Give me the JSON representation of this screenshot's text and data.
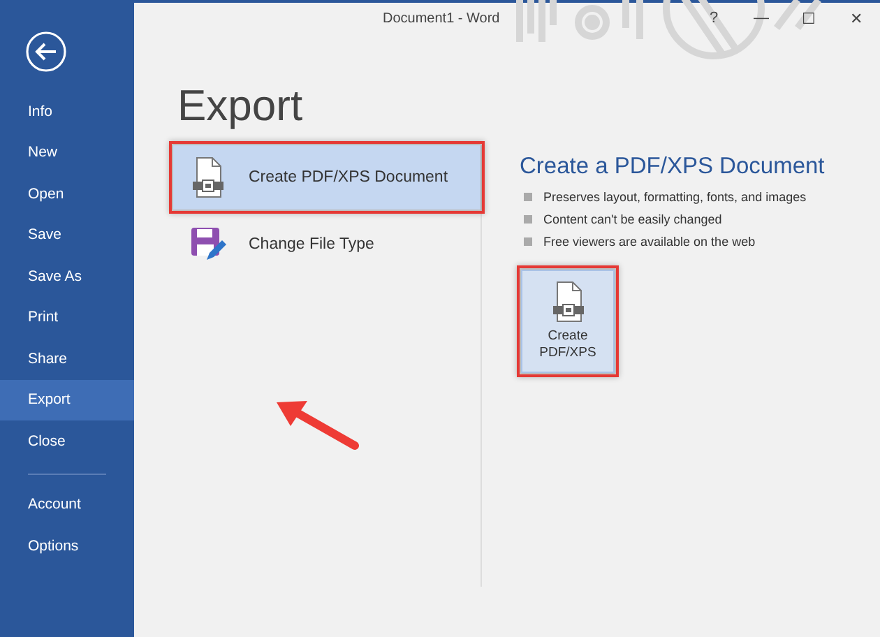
{
  "window": {
    "title": "Document1 - Word",
    "controls": [
      "?",
      "—",
      "☐",
      "✕"
    ]
  },
  "sidebar": {
    "items": [
      {
        "label": "Info",
        "selected": false
      },
      {
        "label": "New",
        "selected": false
      },
      {
        "label": "Open",
        "selected": false
      },
      {
        "label": "Save",
        "selected": false
      },
      {
        "label": "Save As",
        "selected": false
      },
      {
        "label": "Print",
        "selected": false
      },
      {
        "label": "Share",
        "selected": false
      },
      {
        "label": "Export",
        "selected": true
      },
      {
        "label": "Close",
        "selected": false
      },
      {
        "kind": "separator"
      },
      {
        "label": "Account",
        "selected": false
      },
      {
        "label": "Options",
        "selected": false
      }
    ]
  },
  "page_title": "Export",
  "options": [
    {
      "label": "Create PDF/XPS Document",
      "kind": "pdf",
      "selected": true,
      "highlighted": true
    },
    {
      "label": "Change File Type",
      "kind": "save",
      "selected": false,
      "highlighted": false
    }
  ],
  "detail": {
    "title": "Create a PDF/XPS Document",
    "bullets": [
      "Preserves layout, formatting, fonts, and images",
      "Content can't be easily changed",
      "Free viewers are available on the web"
    ],
    "button": {
      "label": "Create PDF/XPS",
      "highlighted": true
    }
  },
  "annotation": {
    "kind": "arrow"
  }
}
